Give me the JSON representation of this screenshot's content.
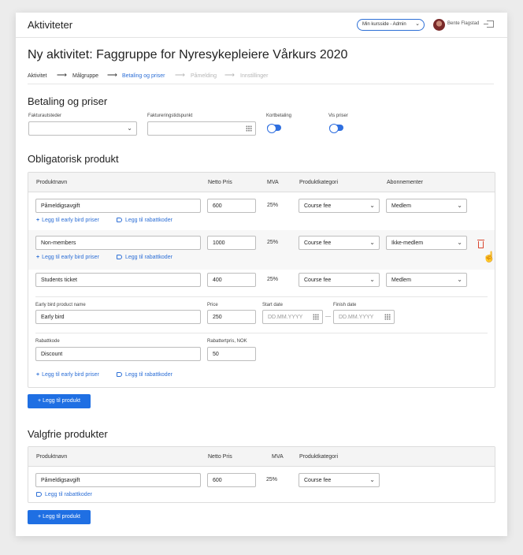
{
  "header": {
    "app_title": "Aktiviteter",
    "course_select": "Min kursside - Admin",
    "user_name": "Bente Flagstad",
    "logout_icon": "logout-icon"
  },
  "page_title": "Ny aktivitet: Faggruppe for Nyresykepleiere Vårkurs 2020",
  "steps": [
    {
      "label": "Aktivitet",
      "state": "done"
    },
    {
      "label": "Målgruppe",
      "state": "done"
    },
    {
      "label": "Betaling og priser",
      "state": "active"
    },
    {
      "label": "Påmelding",
      "state": "todo"
    },
    {
      "label": "Innstillinger",
      "state": "todo"
    }
  ],
  "colors": {
    "accent": "#2d6fd6",
    "done": "#333333",
    "todo": "#b5b5b5",
    "danger": "#d9452f"
  },
  "payment": {
    "heading": "Betaling og priser",
    "invoice_issuer_label": "Fakturautsteder",
    "invoice_issuer_value": "",
    "invoice_time_label": "Faktureringstidspunkt",
    "invoice_time_value": "",
    "card_payment_label": "Kortbetaling",
    "card_payment_on": true,
    "show_prices_label": "Vis priser",
    "show_prices_on": true
  },
  "mandatory": {
    "heading": "Obligatorisk produkt",
    "columns": [
      "Produktnavn",
      "Netto Pris",
      "MVA",
      "Produktkategori",
      "Abonnementer"
    ],
    "rows": [
      {
        "name": "Påmeldigsavgift",
        "price": "600",
        "mva": "25%",
        "category": "Course fee",
        "subscription": "Medlem"
      },
      {
        "name": "Non-members",
        "price": "1000",
        "mva": "25%",
        "category": "Course fee",
        "subscription": "Ikke-medlem"
      },
      {
        "name": "Students ticket",
        "price": "400",
        "mva": "25%",
        "category": "Course fee",
        "subscription": "Medlem"
      }
    ],
    "early_bird": {
      "name_label": "Early bird product name",
      "name_value": "Early bird",
      "price_label": "Price",
      "price_value": "250",
      "start_label": "Start date",
      "start_placeholder": "DD.MM.YYYY",
      "finish_label": "Finish date",
      "finish_placeholder": "DD.MM.YYYY",
      "separator": "—"
    },
    "discount": {
      "code_label": "Rabattkode",
      "code_value": "Discount",
      "price_label": "Rabattertpris, NOK",
      "price_value": "50"
    },
    "add_early_bird_link": "Legg til early bird priser",
    "add_discount_link": "Legg til rabattkoder",
    "add_product_button": "+ Legg til produkt"
  },
  "optional": {
    "heading": "Valgfrie produkter",
    "columns": [
      "Produktnavn",
      "Netto Pris",
      "MVA",
      "Produktkategori"
    ],
    "row": {
      "name": "Påmeldigsavgift",
      "price": "600",
      "mva": "25%",
      "category": "Course fee"
    },
    "add_discount_link": "Legg til rabattkoder",
    "add_product_button": "+ Legg til produkt"
  }
}
